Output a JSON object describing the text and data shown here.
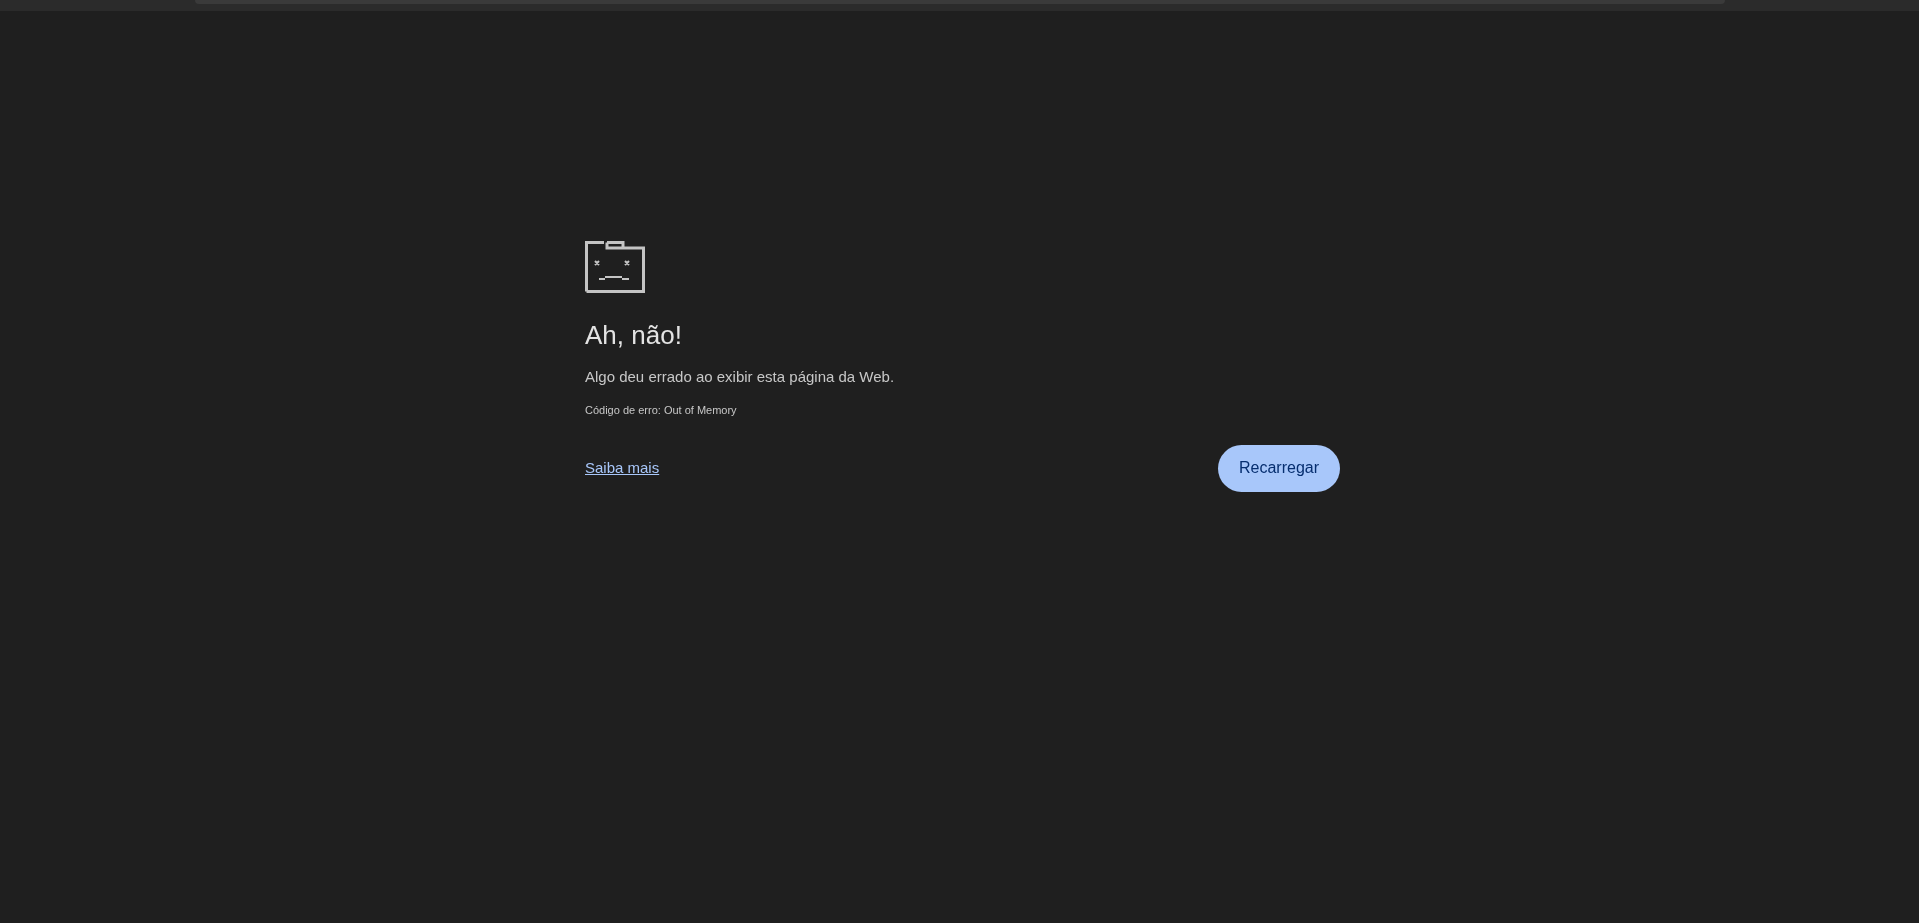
{
  "heading": "Ah, não!",
  "message": "Algo deu errado ao exibir esta página da Web.",
  "error_code": "Código de erro: Out of Memory",
  "learn_more_link": "Saiba mais",
  "reload_button": "Recarregar"
}
